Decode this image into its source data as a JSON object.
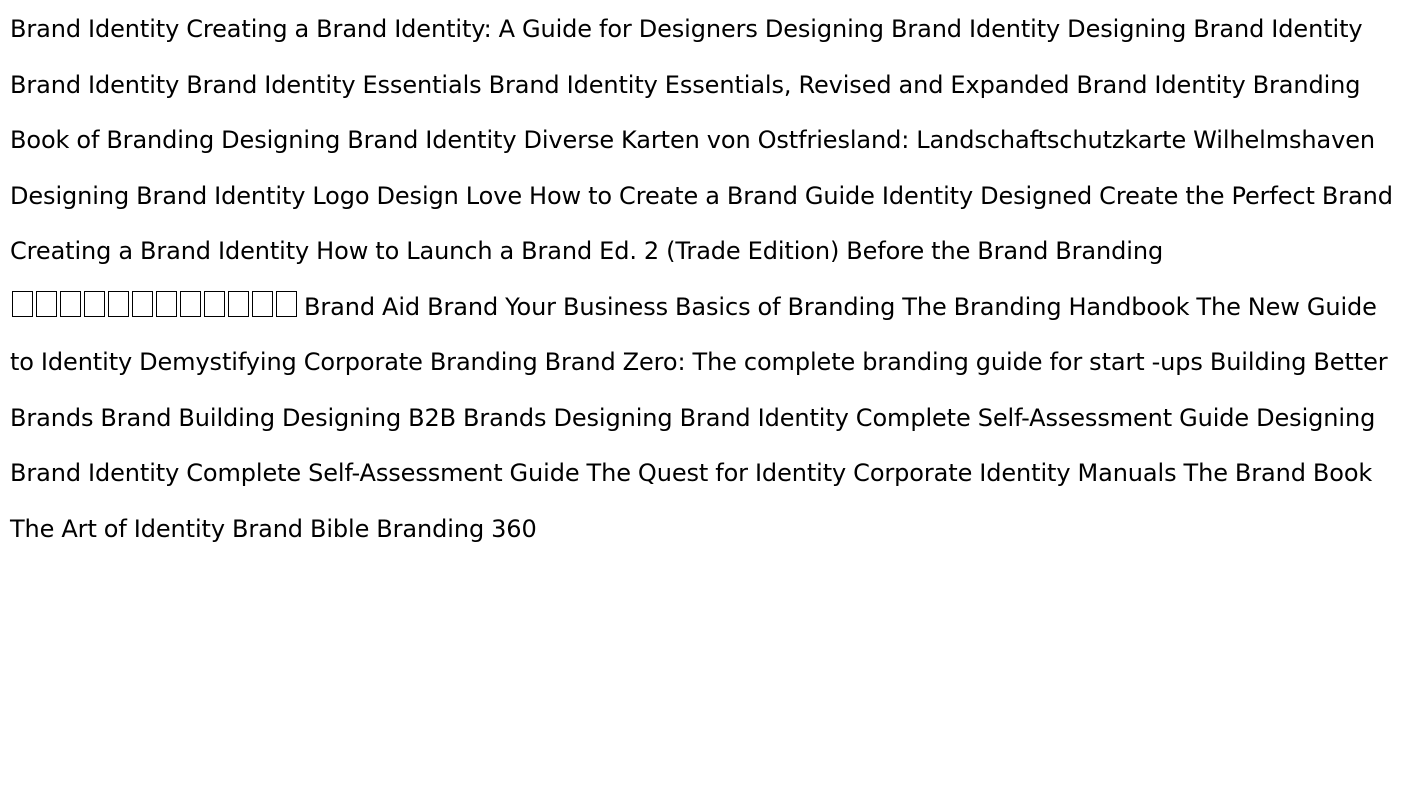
{
  "document": {
    "text_color": "#000000",
    "background": "#ffffff",
    "segments": [
      "Brand Identity Creating a Brand Identity: A Guide for Designers Designing Brand Identity Designing Brand Identity Brand Identity Brand Identity Essentials Brand Identity Essentials, Revised and Expanded Brand Identity Branding Book of Branding Designing Brand Identity Diverse Karten von Ostfriesland: Landschaftschutzkarte Wilhelmshaven Designing Brand Identity Logo Design Love How to Create a Brand Guide Identity Designed Create the Perfect Brand Creating a Brand Identity How to Launch a Brand Ed. 2 (Trade Edition) Before the Brand Branding",
      "Brand Aid Brand Your Business Basics of Branding The Branding Handbook The New Guide to Identity Demystifying Corporate Branding Brand Zero: The complete branding guide for start -ups Building Better Brands Brand Building Designing B2B Brands Designing Brand Identity Complete Self-Assessment Guide Designing Brand Identity Complete Self-Assessment Guide The Quest for Identity Corporate Identity Manuals The Brand Book The Art of Identity Brand Bible Branding 360"
    ],
    "missing_glyph_count": 12
  }
}
